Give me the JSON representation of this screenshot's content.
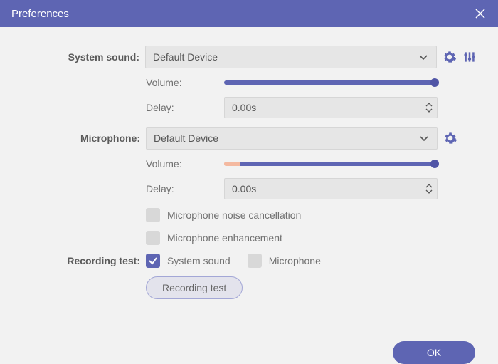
{
  "window": {
    "title": "Preferences"
  },
  "systemSound": {
    "label": "System sound:",
    "device": "Default Device",
    "volumeLabel": "Volume:",
    "delayLabel": "Delay:",
    "delayValue": "0.00s"
  },
  "microphone": {
    "label": "Microphone:",
    "device": "Default Device",
    "volumeLabel": "Volume:",
    "delayLabel": "Delay:",
    "delayValue": "0.00s",
    "noiseCancellationLabel": "Microphone noise cancellation",
    "enhancementLabel": "Microphone enhancement"
  },
  "recordingTest": {
    "label": "Recording test:",
    "systemSoundLabel": "System sound",
    "microphoneLabel": "Microphone",
    "buttonLabel": "Recording test"
  },
  "footer": {
    "okLabel": "OK"
  }
}
